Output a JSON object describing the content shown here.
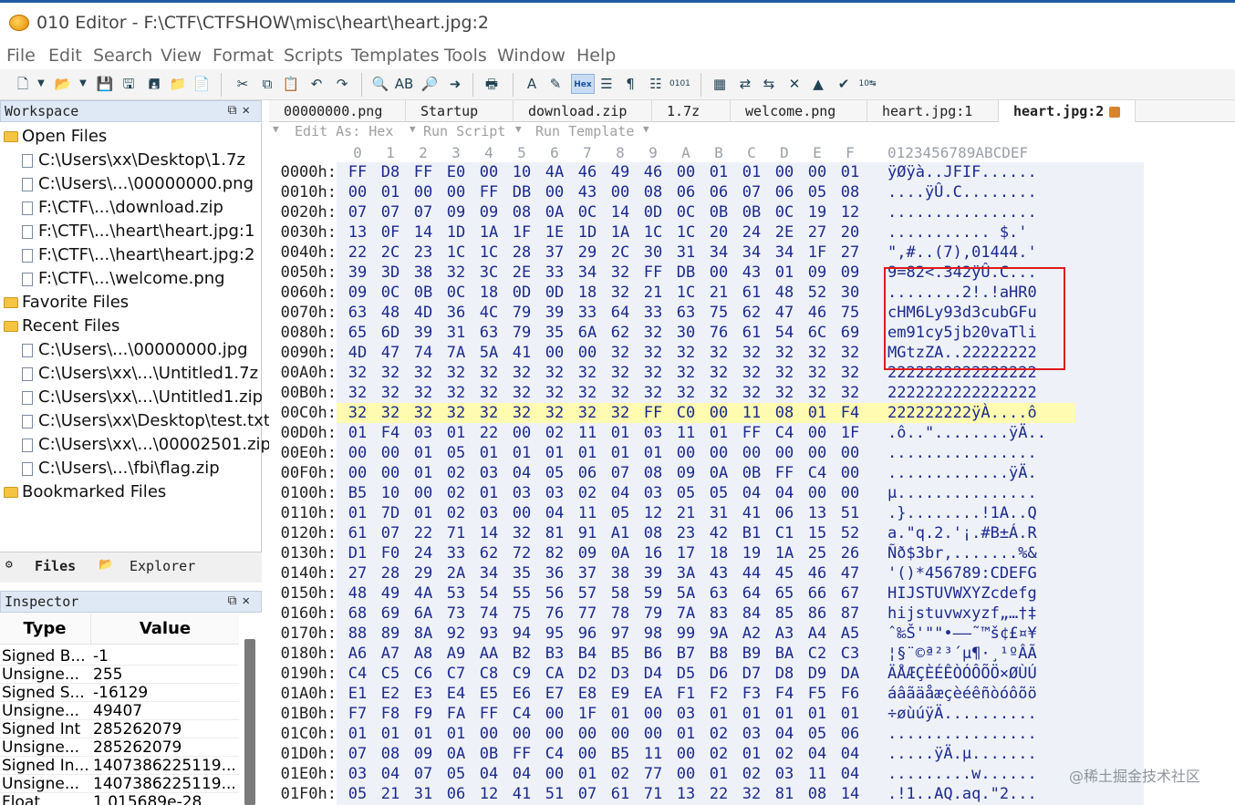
{
  "window": {
    "title": "010 Editor - F:\\CTF\\CTFSHOW\\misc\\heart\\heart.jpg:2"
  },
  "menu": [
    "File",
    "Edit",
    "Search",
    "View",
    "Format",
    "Scripts",
    "Templates",
    "Tools",
    "Window",
    "Help"
  ],
  "toolbar": {
    "hex_label": "Hex"
  },
  "workspace": {
    "title": "Workspace",
    "sections": {
      "open_files": "Open Files",
      "favorite_files": "Favorite Files",
      "recent_files": "Recent Files",
      "bookmarked_files": "Bookmarked Files"
    },
    "open_files": [
      "C:\\Users\\xx\\Desktop\\1.7z",
      "C:\\Users\\...\\00000000.png",
      "F:\\CTF\\...\\download.zip",
      "F:\\CTF\\...\\heart\\heart.jpg:1",
      "F:\\CTF\\...\\heart\\heart.jpg:2",
      "F:\\CTF\\...\\welcome.png"
    ],
    "recent_files": [
      "C:\\Users\\...\\00000000.jpg",
      "C:\\Users\\xx\\...\\Untitled1.7z",
      "C:\\Users\\xx\\...\\Untitled1.zip",
      "C:\\Users\\xx\\Desktop\\test.txt",
      "C:\\Users\\xx\\...\\00002501.zip",
      "C:\\Users\\...\\fbi\\flag.zip"
    ],
    "tabs": [
      "Files",
      "Explorer"
    ]
  },
  "inspector": {
    "title": "Inspector",
    "col_type": "Type",
    "col_value": "Value",
    "rows": [
      {
        "type": "Signed B...",
        "value": "-1"
      },
      {
        "type": "Unsigne...",
        "value": "255"
      },
      {
        "type": "Signed S...",
        "value": "-16129"
      },
      {
        "type": "Unsigne...",
        "value": "49407"
      },
      {
        "type": "Signed Int",
        "value": "285262079"
      },
      {
        "type": "Unsigne...",
        "value": "285262079"
      },
      {
        "type": "Signed In...",
        "value": "1407386225119..."
      },
      {
        "type": "Unsigne...",
        "value": "1407386225119..."
      },
      {
        "type": "Float",
        "value": "1.015689e-28"
      }
    ]
  },
  "file_tabs": [
    {
      "label": "00000000.png",
      "active": false
    },
    {
      "label": "Startup",
      "active": false
    },
    {
      "label": "download.zip",
      "active": false
    },
    {
      "label": "1.7z",
      "active": false
    },
    {
      "label": "welcome.png",
      "active": false
    },
    {
      "label": "heart.jpg:1",
      "active": false
    },
    {
      "label": "heart.jpg:2",
      "active": true
    }
  ],
  "edit_bar": {
    "edit_as": "Edit As: Hex",
    "run_script": "Run Script",
    "run_template": "Run Template"
  },
  "hex": {
    "col_labels": [
      "0",
      "1",
      "2",
      "3",
      "4",
      "5",
      "6",
      "7",
      "8",
      "9",
      "A",
      "B",
      "C",
      "D",
      "E",
      "F"
    ],
    "ascii_header": "0123456789ABCDEF",
    "highlight_row": 12,
    "rows": [
      {
        "addr": "0000h:",
        "bytes": [
          "FF",
          "D8",
          "FF",
          "E0",
          "00",
          "10",
          "4A",
          "46",
          "49",
          "46",
          "00",
          "01",
          "01",
          "00",
          "00",
          "01"
        ],
        "ascii": "ÿØÿà..JFIF......"
      },
      {
        "addr": "0010h:",
        "bytes": [
          "00",
          "01",
          "00",
          "00",
          "FF",
          "DB",
          "00",
          "43",
          "00",
          "08",
          "06",
          "06",
          "07",
          "06",
          "05",
          "08"
        ],
        "ascii": "....ÿÛ.C........"
      },
      {
        "addr": "0020h:",
        "bytes": [
          "07",
          "07",
          "07",
          "09",
          "09",
          "08",
          "0A",
          "0C",
          "14",
          "0D",
          "0C",
          "0B",
          "0B",
          "0C",
          "19",
          "12"
        ],
        "ascii": "................"
      },
      {
        "addr": "0030h:",
        "bytes": [
          "13",
          "0F",
          "14",
          "1D",
          "1A",
          "1F",
          "1E",
          "1D",
          "1A",
          "1C",
          "1C",
          "20",
          "24",
          "2E",
          "27",
          "20"
        ],
        "ascii": "........... $.' "
      },
      {
        "addr": "0040h:",
        "bytes": [
          "22",
          "2C",
          "23",
          "1C",
          "1C",
          "28",
          "37",
          "29",
          "2C",
          "30",
          "31",
          "34",
          "34",
          "34",
          "1F",
          "27"
        ],
        "ascii": "\",#..(7),01444.'"
      },
      {
        "addr": "0050h:",
        "bytes": [
          "39",
          "3D",
          "38",
          "32",
          "3C",
          "2E",
          "33",
          "34",
          "32",
          "FF",
          "DB",
          "00",
          "43",
          "01",
          "09",
          "09"
        ],
        "ascii": "9=82<.342ÿÛ.C..."
      },
      {
        "addr": "0060h:",
        "bytes": [
          "09",
          "0C",
          "0B",
          "0C",
          "18",
          "0D",
          "0D",
          "18",
          "32",
          "21",
          "1C",
          "21",
          "61",
          "48",
          "52",
          "30"
        ],
        "ascii": "........2!.!aHR0"
      },
      {
        "addr": "0070h:",
        "bytes": [
          "63",
          "48",
          "4D",
          "36",
          "4C",
          "79",
          "39",
          "33",
          "64",
          "33",
          "63",
          "75",
          "62",
          "47",
          "46",
          "75"
        ],
        "ascii": "cHM6Ly93d3cubGFu"
      },
      {
        "addr": "0080h:",
        "bytes": [
          "65",
          "6D",
          "39",
          "31",
          "63",
          "79",
          "35",
          "6A",
          "62",
          "32",
          "30",
          "76",
          "61",
          "54",
          "6C",
          "69"
        ],
        "ascii": "em91cy5jb20vaTli"
      },
      {
        "addr": "0090h:",
        "bytes": [
          "4D",
          "47",
          "74",
          "7A",
          "5A",
          "41",
          "00",
          "00",
          "32",
          "32",
          "32",
          "32",
          "32",
          "32",
          "32",
          "32"
        ],
        "ascii": "MGtzZA..22222222"
      },
      {
        "addr": "00A0h:",
        "bytes": [
          "32",
          "32",
          "32",
          "32",
          "32",
          "32",
          "32",
          "32",
          "32",
          "32",
          "32",
          "32",
          "32",
          "32",
          "32",
          "32"
        ],
        "ascii": "2222222222222222"
      },
      {
        "addr": "00B0h:",
        "bytes": [
          "32",
          "32",
          "32",
          "32",
          "32",
          "32",
          "32",
          "32",
          "32",
          "32",
          "32",
          "32",
          "32",
          "32",
          "32",
          "32"
        ],
        "ascii": "2222222222222222"
      },
      {
        "addr": "00C0h:",
        "bytes": [
          "32",
          "32",
          "32",
          "32",
          "32",
          "32",
          "32",
          "32",
          "32",
          "FF",
          "C0",
          "00",
          "11",
          "08",
          "01",
          "F4"
        ],
        "ascii": "222222222ÿÀ....ô"
      },
      {
        "addr": "00D0h:",
        "bytes": [
          "01",
          "F4",
          "03",
          "01",
          "22",
          "00",
          "02",
          "11",
          "01",
          "03",
          "11",
          "01",
          "FF",
          "C4",
          "00",
          "1F"
        ],
        "ascii": ".ô..\"........ÿÄ.."
      },
      {
        "addr": "00E0h:",
        "bytes": [
          "00",
          "00",
          "01",
          "05",
          "01",
          "01",
          "01",
          "01",
          "01",
          "01",
          "00",
          "00",
          "00",
          "00",
          "00",
          "00"
        ],
        "ascii": "................"
      },
      {
        "addr": "00F0h:",
        "bytes": [
          "00",
          "00",
          "01",
          "02",
          "03",
          "04",
          "05",
          "06",
          "07",
          "08",
          "09",
          "0A",
          "0B",
          "FF",
          "C4",
          "00"
        ],
        "ascii": ".............ÿÄ."
      },
      {
        "addr": "0100h:",
        "bytes": [
          "B5",
          "10",
          "00",
          "02",
          "01",
          "03",
          "03",
          "02",
          "04",
          "03",
          "05",
          "05",
          "04",
          "04",
          "00",
          "00"
        ],
        "ascii": "µ..............."
      },
      {
        "addr": "0110h:",
        "bytes": [
          "01",
          "7D",
          "01",
          "02",
          "03",
          "00",
          "04",
          "11",
          "05",
          "12",
          "21",
          "31",
          "41",
          "06",
          "13",
          "51"
        ],
        "ascii": ".}........!1A..Q"
      },
      {
        "addr": "0120h:",
        "bytes": [
          "61",
          "07",
          "22",
          "71",
          "14",
          "32",
          "81",
          "91",
          "A1",
          "08",
          "23",
          "42",
          "B1",
          "C1",
          "15",
          "52"
        ],
        "ascii": "a.\"q.2.'¡.#B±Á.R"
      },
      {
        "addr": "0130h:",
        "bytes": [
          "D1",
          "F0",
          "24",
          "33",
          "62",
          "72",
          "82",
          "09",
          "0A",
          "16",
          "17",
          "18",
          "19",
          "1A",
          "25",
          "26"
        ],
        "ascii": "Ñð$3br,.......%&"
      },
      {
        "addr": "0140h:",
        "bytes": [
          "27",
          "28",
          "29",
          "2A",
          "34",
          "35",
          "36",
          "37",
          "38",
          "39",
          "3A",
          "43",
          "44",
          "45",
          "46",
          "47"
        ],
        "ascii": "'()*456789:CDEFG"
      },
      {
        "addr": "0150h:",
        "bytes": [
          "48",
          "49",
          "4A",
          "53",
          "54",
          "55",
          "56",
          "57",
          "58",
          "59",
          "5A",
          "63",
          "64",
          "65",
          "66",
          "67"
        ],
        "ascii": "HIJSTUVWXYZcdefg"
      },
      {
        "addr": "0160h:",
        "bytes": [
          "68",
          "69",
          "6A",
          "73",
          "74",
          "75",
          "76",
          "77",
          "78",
          "79",
          "7A",
          "83",
          "84",
          "85",
          "86",
          "87"
        ],
        "ascii": "hijstuvwxyzf„…†‡"
      },
      {
        "addr": "0170h:",
        "bytes": [
          "88",
          "89",
          "8A",
          "92",
          "93",
          "94",
          "95",
          "96",
          "97",
          "98",
          "99",
          "9A",
          "A2",
          "A3",
          "A4",
          "A5"
        ],
        "ascii": "ˆ‰Š'\"\"•–—˜™š¢£¤¥"
      },
      {
        "addr": "0180h:",
        "bytes": [
          "A6",
          "A7",
          "A8",
          "A9",
          "AA",
          "B2",
          "B3",
          "B4",
          "B5",
          "B6",
          "B7",
          "B8",
          "B9",
          "BA",
          "C2",
          "C3"
        ],
        "ascii": "¦§¨©ª²³´µ¶·¸¹ºÂÃ"
      },
      {
        "addr": "0190h:",
        "bytes": [
          "C4",
          "C5",
          "C6",
          "C7",
          "C8",
          "C9",
          "CA",
          "D2",
          "D3",
          "D4",
          "D5",
          "D6",
          "D7",
          "D8",
          "D9",
          "DA"
        ],
        "ascii": "ÄÅÆÇÈÉÊÒÓÔÕÖ×ØÙÚ"
      },
      {
        "addr": "01A0h:",
        "bytes": [
          "E1",
          "E2",
          "E3",
          "E4",
          "E5",
          "E6",
          "E7",
          "E8",
          "E9",
          "EA",
          "F1",
          "F2",
          "F3",
          "F4",
          "F5",
          "F6"
        ],
        "ascii": "áâãäåæçèéêñòóôõö"
      },
      {
        "addr": "01B0h:",
        "bytes": [
          "F7",
          "F8",
          "F9",
          "FA",
          "FF",
          "C4",
          "00",
          "1F",
          "01",
          "00",
          "03",
          "01",
          "01",
          "01",
          "01",
          "01"
        ],
        "ascii": "÷øùúÿÄ.........."
      },
      {
        "addr": "01C0h:",
        "bytes": [
          "01",
          "01",
          "01",
          "01",
          "00",
          "00",
          "00",
          "00",
          "00",
          "00",
          "01",
          "02",
          "03",
          "04",
          "05",
          "06"
        ],
        "ascii": "................"
      },
      {
        "addr": "01D0h:",
        "bytes": [
          "07",
          "08",
          "09",
          "0A",
          "0B",
          "FF",
          "C4",
          "00",
          "B5",
          "11",
          "00",
          "02",
          "01",
          "02",
          "04",
          "04"
        ],
        "ascii": ".....ÿÄ.µ......."
      },
      {
        "addr": "01E0h:",
        "bytes": [
          "03",
          "04",
          "07",
          "05",
          "04",
          "04",
          "00",
          "01",
          "02",
          "77",
          "00",
          "01",
          "02",
          "03",
          "11",
          "04"
        ],
        "ascii": ".........w......"
      },
      {
        "addr": "01F0h:",
        "bytes": [
          "05",
          "21",
          "31",
          "06",
          "12",
          "41",
          "51",
          "07",
          "61",
          "71",
          "13",
          "22",
          "32",
          "81",
          "08",
          "14"
        ],
        "ascii": ".!1..AQ.aq.\"2..."
      }
    ]
  },
  "watermark": "@稀土掘金技术社区"
}
